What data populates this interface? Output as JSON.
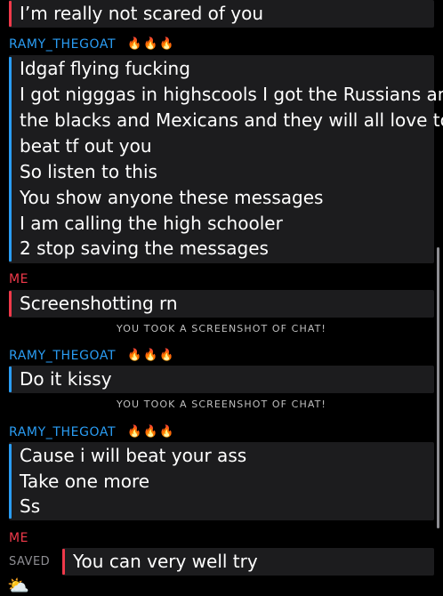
{
  "messages": [
    {
      "lines": [
        "I’m really not scared of you"
      ]
    },
    {
      "sender": "RAMY_THEGOAT",
      "sender_emoji": "🔥🔥🔥",
      "lines": [
        "Idgaf flying fucking",
        "I got nigggas in highscools I got the Russians and",
        "the blacks and Mexicans and they will all love to",
        "beat tf out you",
        "So listen to this",
        "You show anyone these messages",
        "I am calling the high schooler",
        "2 stop saving the messages"
      ]
    },
    {
      "sender": "ME",
      "lines": [
        "Screenshotting rn"
      ]
    },
    {
      "sender": "RAMY_THEGOAT",
      "sender_emoji": "🔥🔥🔥",
      "lines": [
        "Do it kissy"
      ]
    },
    {
      "sender": "RAMY_THEGOAT",
      "sender_emoji": "🔥🔥🔥",
      "lines": [
        "Cause i will beat your ass",
        "Take one more",
        "Ss"
      ]
    },
    {
      "sender": "ME",
      "saved_label": "SAVED",
      "lines": [
        "You can very well try"
      ]
    }
  ],
  "system_notices": [
    "YOU TOOK A SCREENSHOT OF CHAT!",
    "YOU TOOK A SCREENSHOT OF CHAT!"
  ],
  "colors": {
    "me": "#f0394a",
    "friend": "#2a9df4",
    "bubble": "#1c1c1e",
    "background": "#000000"
  },
  "bottom_emoji": "⛅"
}
